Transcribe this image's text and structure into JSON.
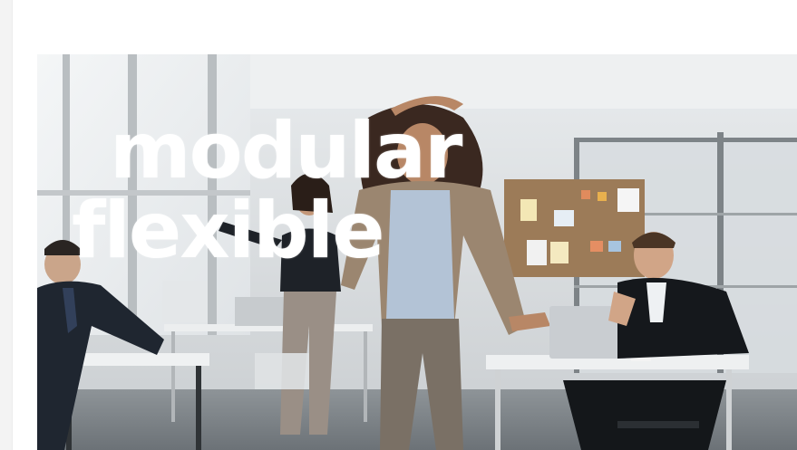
{
  "video": {
    "overlay_words": [
      "modular",
      "flexible"
    ]
  },
  "scene_description_icons": {
    "frame": "office-video-frame"
  },
  "colors": {
    "overlay_text": "#ffffff",
    "page_background": "#ffffff"
  }
}
